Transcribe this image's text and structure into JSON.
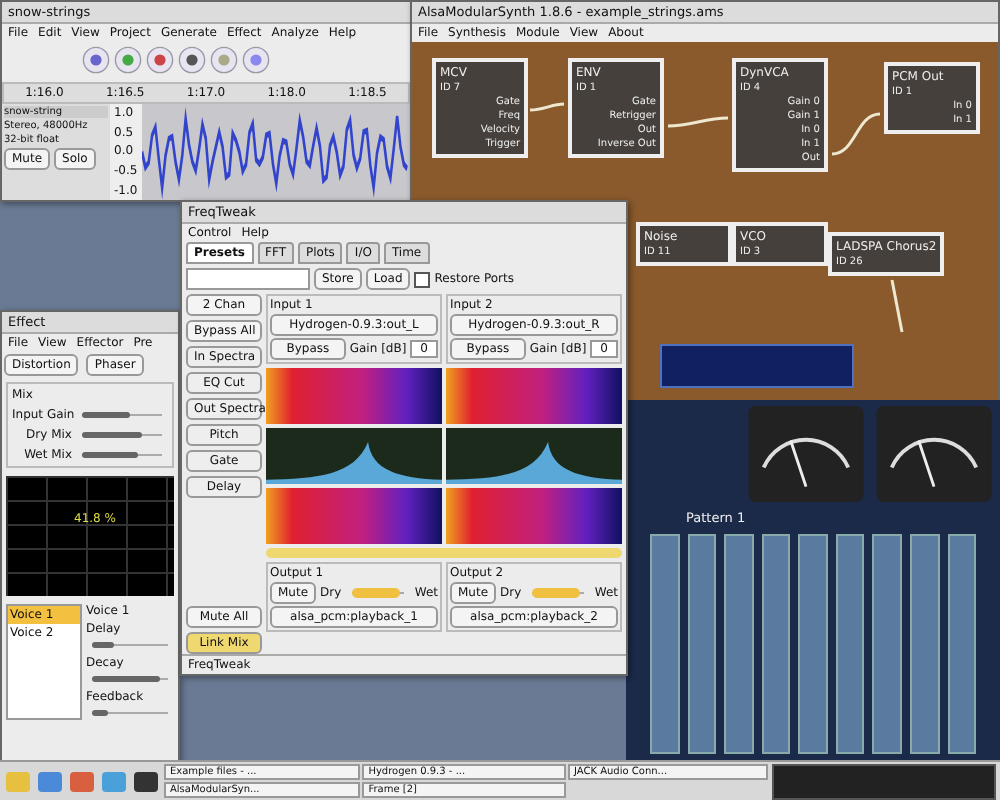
{
  "audacity": {
    "title": "snow-strings",
    "menu": [
      "File",
      "Edit",
      "View",
      "Project",
      "Generate",
      "Effect",
      "Analyze",
      "Help"
    ],
    "ruler": [
      "1:16.0",
      "1:16.5",
      "1:17.0",
      "1:18.0",
      "1:18.5"
    ],
    "track": {
      "name": "snow-string",
      "info": [
        "Stereo, 48000Hz",
        "32-bit float"
      ],
      "mute": "Mute",
      "solo": "Solo"
    },
    "axis": [
      "1.0",
      "0.5",
      "0.0",
      "-0.5",
      "-1.0"
    ]
  },
  "synth": {
    "title": "AlsaModularSynth 1.8.6 - example_strings.ams",
    "menu": [
      "File",
      "Synthesis",
      "Module",
      "View",
      "About"
    ],
    "modules": [
      {
        "name": "MCV",
        "id": "ID 7",
        "ports": [
          "Gate",
          "Freq",
          "Velocity",
          "Trigger"
        ]
      },
      {
        "name": "ENV",
        "id": "ID 1",
        "ports": [
          "Gate",
          "Retrigger",
          "Out",
          "Inverse Out"
        ]
      },
      {
        "name": "DynVCA",
        "id": "ID 4",
        "ports": [
          "Gain 0",
          "Gain 1",
          "In 0",
          "In 1",
          "Out"
        ]
      },
      {
        "name": "PCM Out",
        "id": "ID 1",
        "ports": [
          "In 0",
          "In 1"
        ]
      },
      {
        "name": "Noise",
        "id": "ID 11"
      },
      {
        "name": "VCO",
        "id": "ID 3"
      },
      {
        "name": "LADSPA Chorus2",
        "id": "ID 26"
      }
    ]
  },
  "freqtweak": {
    "title": "FreqTweak",
    "menu": [
      "Control",
      "Help"
    ],
    "tabs": [
      {
        "label": "Presets",
        "selected": true
      },
      {
        "label": "FFT",
        "selected": false
      },
      {
        "label": "Plots",
        "selected": false
      },
      {
        "label": "I/O",
        "selected": false
      },
      {
        "label": "Time",
        "selected": false
      }
    ],
    "store": "Store",
    "load": "Load",
    "restore_ports": {
      "label": "Restore Ports",
      "checked": false
    },
    "chan": "2 Chan",
    "bypass_all": "Bypass All",
    "inputs": [
      {
        "title": "Input 1",
        "port": "Hydrogen-0.9.3:out_L",
        "bypass": "Bypass",
        "gain_label": "Gain [dB]",
        "gain": "0"
      },
      {
        "title": "Input 2",
        "port": "Hydrogen-0.9.3:out_R",
        "bypass": "Bypass",
        "gain_label": "Gain [dB]",
        "gain": "0"
      }
    ],
    "rows": [
      {
        "kind": "spectrogram",
        "label": "In Spectra"
      },
      {
        "kind": "plot",
        "label": "EQ Cut"
      },
      {
        "kind": "spectrogram",
        "label": "Out Spectra"
      }
    ],
    "side_buttons": [
      "Pitch",
      "Gate",
      "Delay"
    ],
    "outputs": [
      {
        "title": "Output 1",
        "mute": "Mute",
        "dry": "Dry",
        "wet": "Wet",
        "level": 0.9,
        "port": "alsa_pcm:playback_1"
      },
      {
        "title": "Output 2",
        "mute": "Mute",
        "dry": "Dry",
        "wet": "Wet",
        "level": 0.9,
        "port": "alsa_pcm:playback_2"
      }
    ],
    "mute_all": "Mute All",
    "link_mix": "Link Mix",
    "status": "FreqTweak"
  },
  "effect": {
    "title": "Effect",
    "menu": [
      "File",
      "View",
      "Effector",
      "Pre"
    ],
    "tabs": [
      "Distortion",
      "Phaser"
    ],
    "mix_title": "Mix",
    "mix": [
      {
        "label": "Input Gain",
        "level": 0.6
      },
      {
        "label": "Dry Mix",
        "level": 0.75
      },
      {
        "label": "Wet Mix",
        "level": 0.7
      }
    ],
    "graph_label": "41.8 %",
    "voices": [
      {
        "label": "Voice 1",
        "selected": true
      },
      {
        "label": "Voice 2",
        "selected": false
      }
    ],
    "voice_title": "Voice 1",
    "voice_sliders": [
      {
        "label": "Delay",
        "level": 0.3
      },
      {
        "label": "Decay",
        "level": 0.9
      },
      {
        "label": "Feedback",
        "level": 0.2
      }
    ]
  },
  "mixer": {
    "title": "Pattern 1"
  },
  "taskbar": {
    "tasks": [
      "Example files - ...",
      "Hydrogen 0.9.3 - ...",
      "JACK Audio Conn...",
      "AlsaModularSyn...",
      "Frame [2]"
    ]
  }
}
